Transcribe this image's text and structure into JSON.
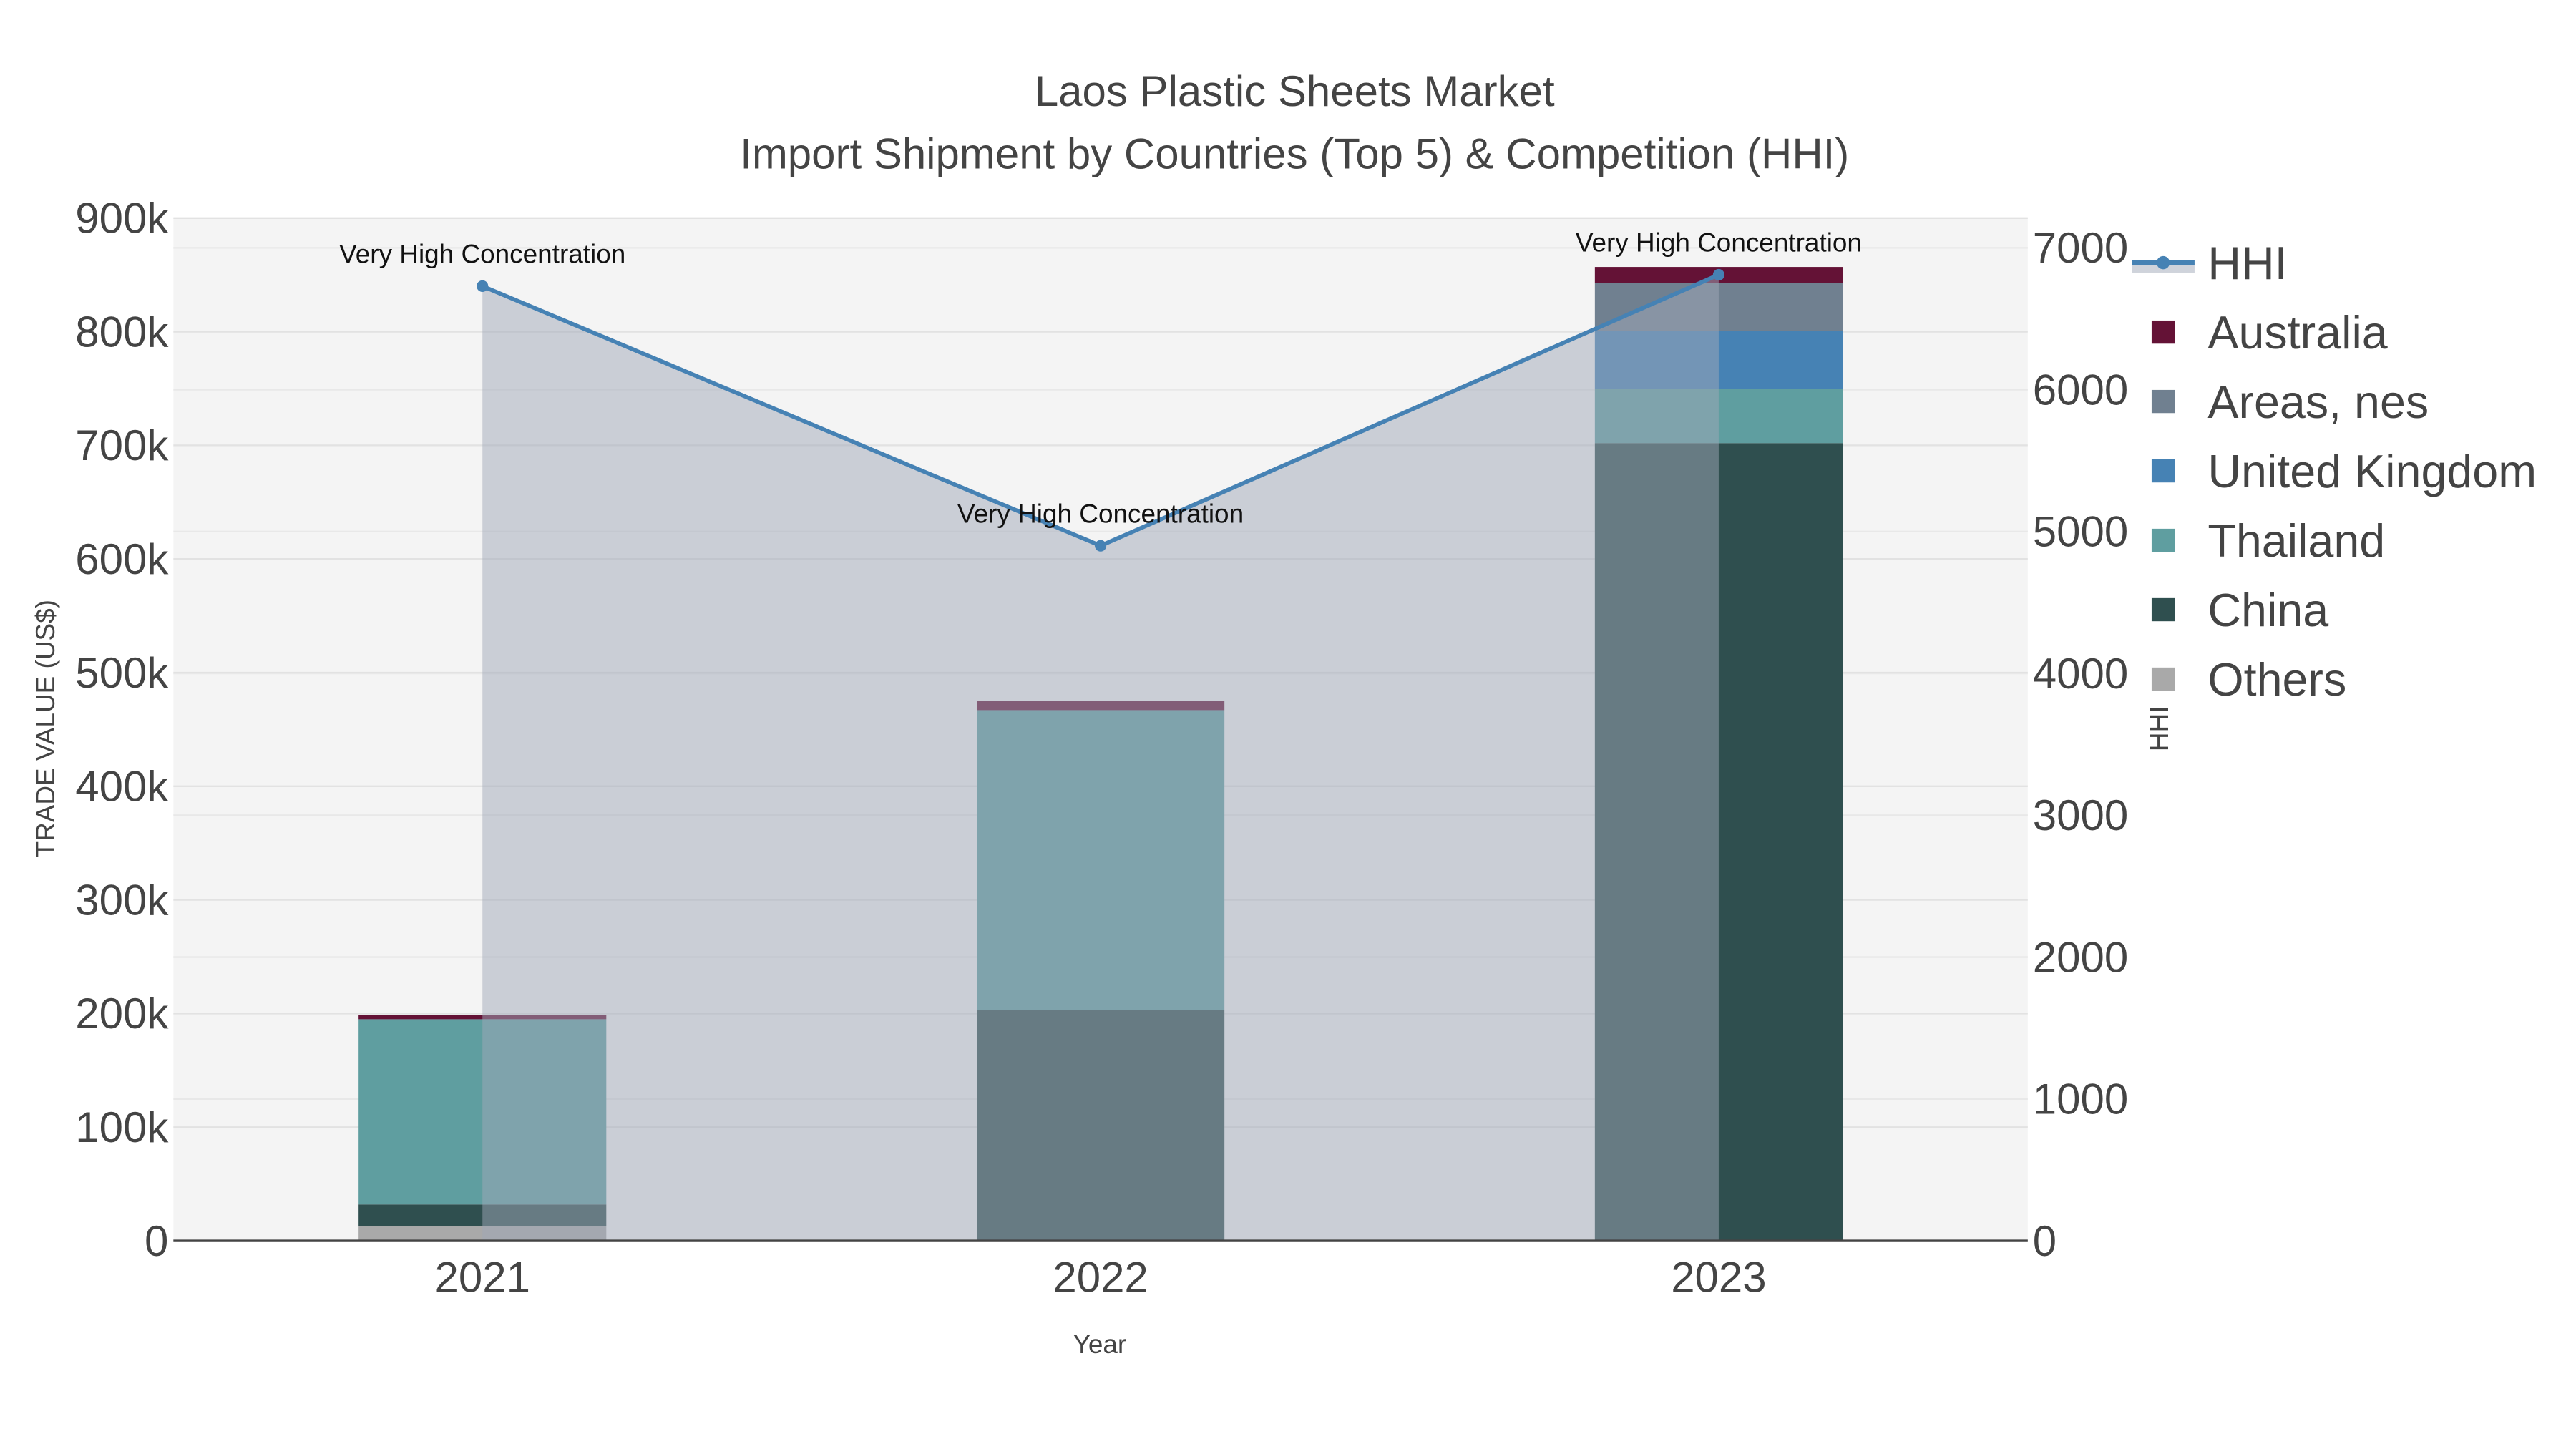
{
  "chart_data": {
    "type": "bar",
    "title": "Laos Plastic Sheets Market",
    "subtitle": "Import Shipment by Countries (Top 5) & Competition (HHI)",
    "xlabel": "Year",
    "ylabel": "TRADE VALUE (US$)",
    "y2label": "HHI",
    "categories": [
      "2021",
      "2022",
      "2023"
    ],
    "ylim": [
      0,
      900000
    ],
    "y2lim": [
      0,
      7000
    ],
    "yticks": [
      "0",
      "100k",
      "200k",
      "300k",
      "400k",
      "500k",
      "600k",
      "700k",
      "800k",
      "900k"
    ],
    "y2ticks": [
      "0",
      "1000",
      "2000",
      "3000",
      "4000",
      "5000",
      "6000",
      "7000"
    ],
    "stacked": true,
    "series": [
      {
        "name": "Others",
        "color": "#a9a9a9",
        "values": [
          13000,
          0,
          0
        ]
      },
      {
        "name": "China",
        "color": "#2f4f4f",
        "values": [
          19000,
          203000,
          702000
        ]
      },
      {
        "name": "Thailand",
        "color": "#5f9ea0",
        "values": [
          163000,
          264000,
          48000
        ]
      },
      {
        "name": "United Kingdom",
        "color": "#4682b4",
        "values": [
          0,
          0,
          51000
        ]
      },
      {
        "name": "Areas, nes",
        "color": "#708090",
        "values": [
          0,
          0,
          42000
        ]
      },
      {
        "name": "Australia",
        "color": "#641236",
        "values": [
          4000,
          8000,
          14000
        ]
      }
    ],
    "line": {
      "name": "HHI",
      "color": "#4682b4",
      "values": [
        6730,
        4900,
        6810
      ]
    },
    "annotations": [
      "Very High Concentration",
      "Very High Concentration",
      "Very High Concentration"
    ],
    "legend_order": [
      "HHI",
      "Australia",
      "Areas, nes",
      "United Kingdom",
      "Thailand",
      "China",
      "Others"
    ],
    "legend_position": "right",
    "grid": true
  }
}
